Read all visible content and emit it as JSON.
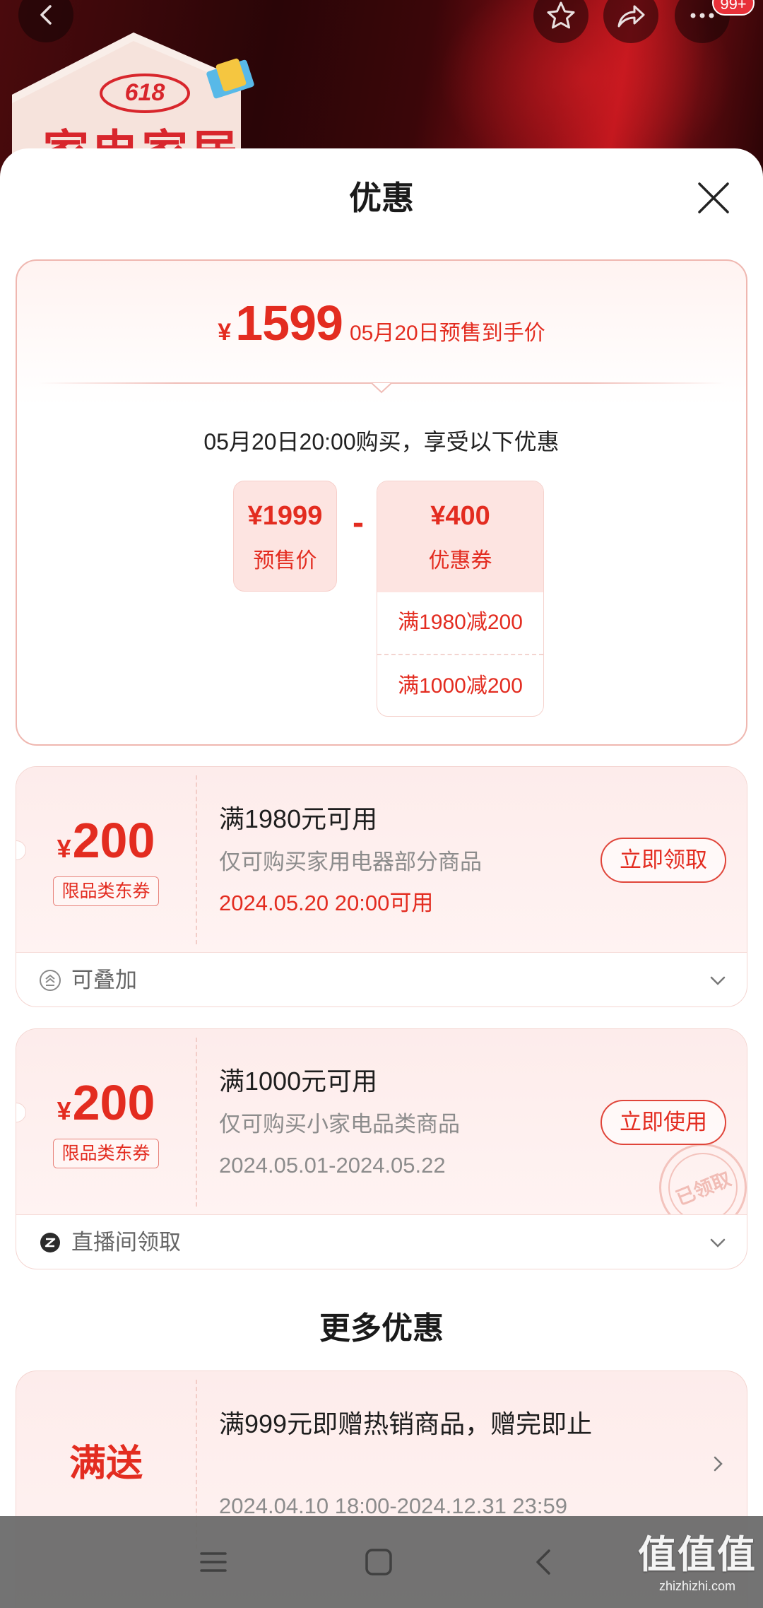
{
  "top_bar": {
    "badge": "99+",
    "logo": {
      "number": "618",
      "title": "家电家居"
    },
    "icons": [
      "back-icon",
      "star-icon",
      "share-icon",
      "more-icon"
    ]
  },
  "sheet": {
    "title": "优惠",
    "close_icon": "close-icon"
  },
  "price_card": {
    "currency": "¥",
    "final_price": "1599",
    "final_label": "05月20日预售到手价",
    "purchase_note": "05月20日20:00购买，享受以下优惠",
    "presale": {
      "amount": "¥1999",
      "label": "预售价"
    },
    "operator": "-",
    "coupon": {
      "amount": "¥400",
      "label": "优惠券",
      "items": [
        "满1980减200",
        "满1000减200"
      ]
    }
  },
  "coupons": [
    {
      "currency": "¥",
      "amount": "200",
      "type": "限品类东券",
      "condition": "满1980元可用",
      "scope": "仅可购买家用电器部分商品",
      "validity": "2024.05.20 20:00可用",
      "button": "立即领取",
      "footer": "可叠加",
      "footer_icon": "stackable-icon"
    },
    {
      "currency": "¥",
      "amount": "200",
      "type": "限品类东券",
      "condition": "满1000元可用",
      "scope": "仅可购买小家电品类商品",
      "validity": "2024.05.01-2024.05.22",
      "button": "立即使用",
      "stamp": "已领取",
      "footer": "直播间领取",
      "footer_icon": "live-icon"
    }
  ],
  "more": {
    "title": "更多优惠",
    "items": [
      {
        "tag": "满送",
        "title": "满999元即赠热销商品，赠完即止",
        "period": "2024.04.10 18:00-2024.12.31 23:59"
      }
    ]
  },
  "nav": {
    "icons": [
      "menu-icon",
      "home-icon",
      "back-icon"
    ]
  },
  "watermark": {
    "text": "值值值",
    "domain": "zhizhizhi.com"
  },
  "colors": {
    "accent": "#e32c20",
    "coupon_bg": "#fdeceb",
    "border": "#efb7b0",
    "hero": "#2a0507"
  }
}
